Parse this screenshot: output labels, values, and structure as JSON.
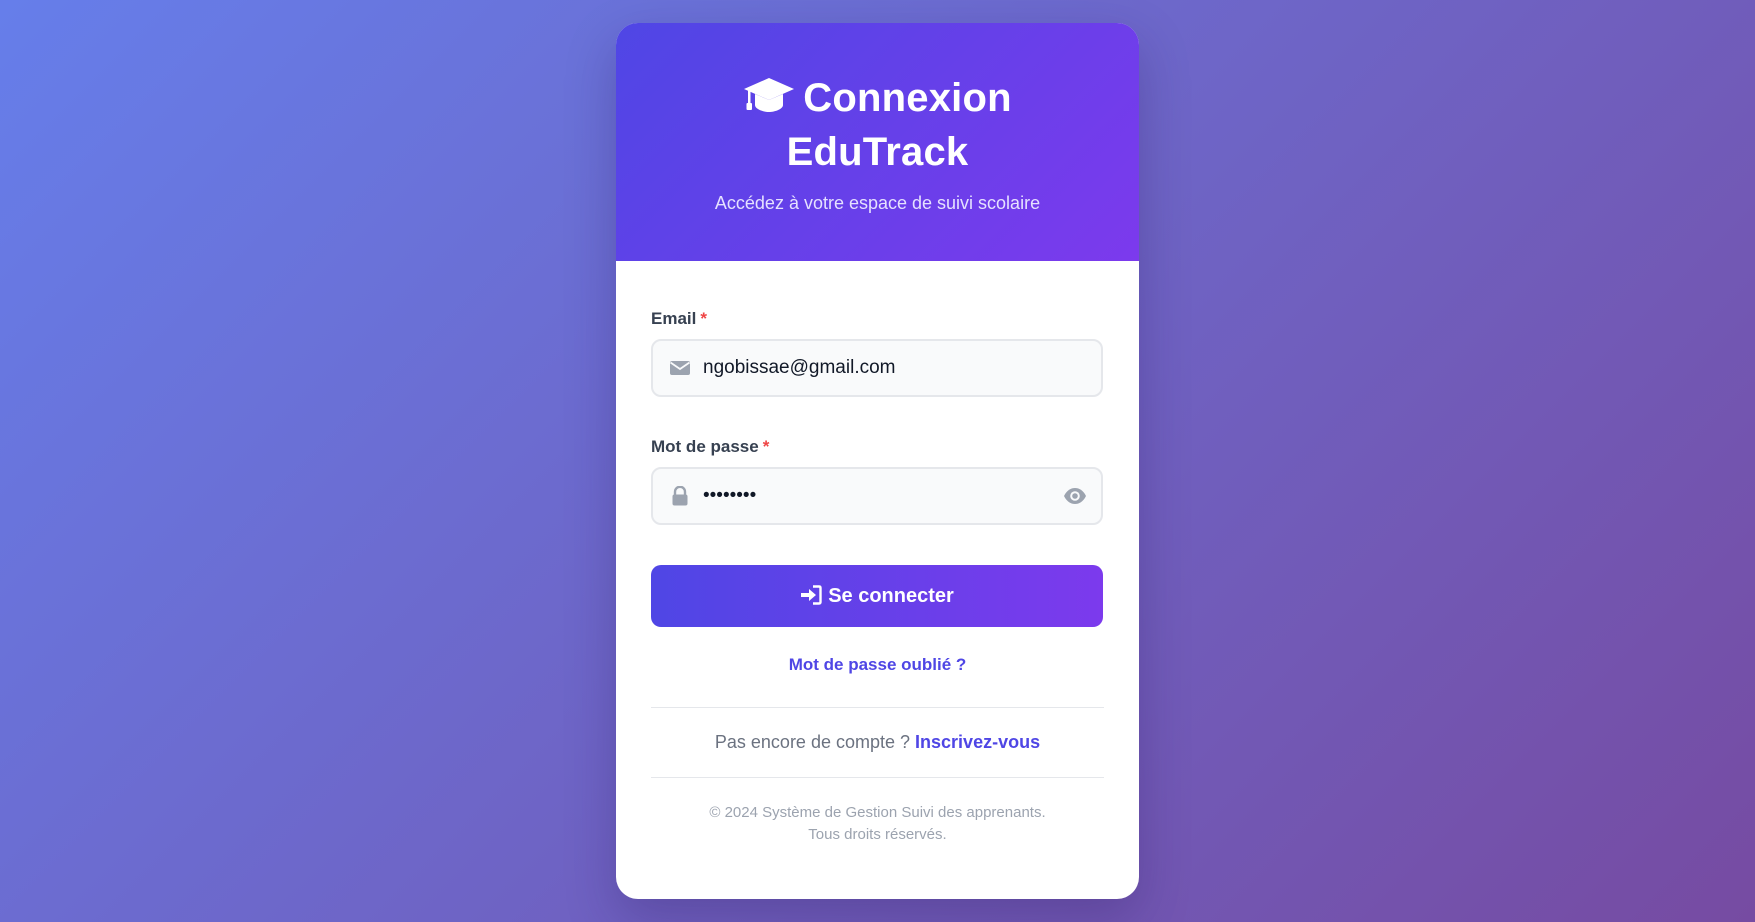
{
  "header": {
    "title_line1": "Connexion",
    "title_line2": "EduTrack",
    "subtitle": "Accédez à votre espace de suivi scolaire",
    "icon": "graduation-cap-icon"
  },
  "form": {
    "email": {
      "label": "Email",
      "required_mark": "*",
      "value": "ngobissae@gmail.com",
      "icon": "envelope-icon"
    },
    "password": {
      "label": "Mot de passe",
      "required_mark": "*",
      "value": "••••••••",
      "icon": "lock-icon",
      "toggle_icon": "eye-icon"
    },
    "submit_label": "Se connecter",
    "submit_icon": "sign-in-icon"
  },
  "links": {
    "forgot_password": "Mot de passe oublié ?",
    "register_prompt": "Pas encore de compte ?",
    "register_link": "Inscrivez-vous"
  },
  "footer": {
    "line1": "© 2024 Système de Gestion Suivi des apprenants.",
    "line2": "Tous droits réservés."
  },
  "colors": {
    "accent": "#4f46e5",
    "accent_end": "#7c3aed",
    "required": "#ef4444"
  }
}
